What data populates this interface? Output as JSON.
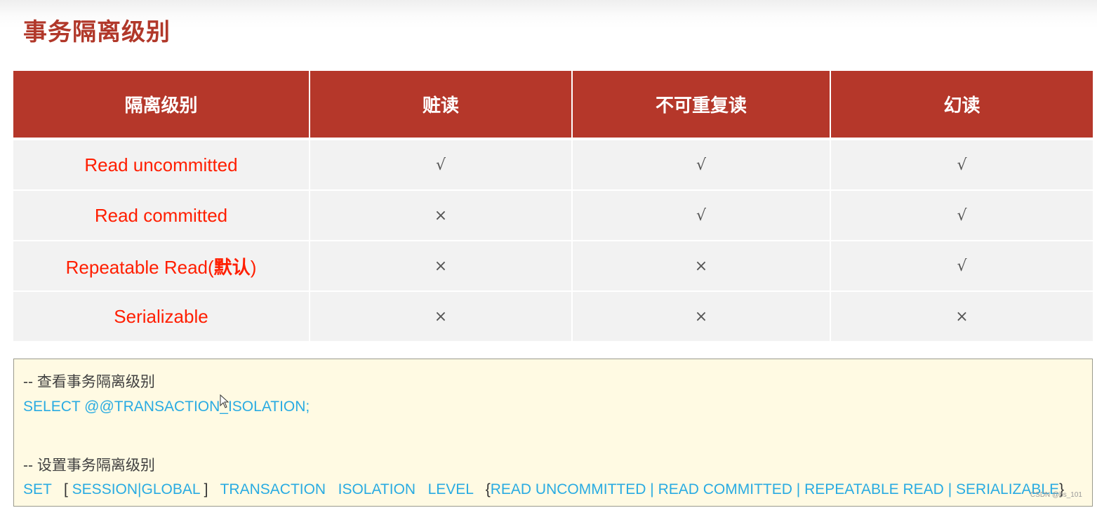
{
  "page": {
    "title": "事务隔离级别"
  },
  "table": {
    "headers": [
      "隔离级别",
      "赃读",
      "不可重复读",
      "幻读"
    ],
    "rows": [
      {
        "level": "Read uncommitted",
        "level_suffix": "",
        "dirty_read": "√",
        "non_repeatable_read": "√",
        "phantom_read": "√"
      },
      {
        "level": "Read committed",
        "level_suffix": "",
        "dirty_read": "×",
        "non_repeatable_read": "√",
        "phantom_read": "√"
      },
      {
        "level": "Repeatable Read(",
        "level_suffix": "默认",
        "level_close": ")",
        "dirty_read": "×",
        "non_repeatable_read": "×",
        "phantom_read": "√"
      },
      {
        "level": "Serializable",
        "level_suffix": "",
        "dirty_read": "×",
        "non_repeatable_read": "×",
        "phantom_read": "×"
      }
    ],
    "colors": {
      "header_bg": "#b5372a",
      "header_text": "#ffffff",
      "level_text": "#ff1e00",
      "cell_bg": "#f2f2f2"
    }
  },
  "code": {
    "comment_view": "-- 查看事务隔离级别",
    "select_stmt": "SELECT @@TRANSACTION_ISOLATION;",
    "comment_set": "-- 设置事务隔离级别",
    "set_parts": {
      "set": "SET",
      "open_bracket": "[",
      "session": "SESSION",
      "pipe1": "|",
      "global": "GLOBAL",
      "close_bracket": "]",
      "transaction": "TRANSACTION",
      "isolation": "ISOLATION",
      "level": "LEVEL",
      "open_brace": "{",
      "opt1": "READ UNCOMMITTED",
      "opt2": "READ COMMITTED",
      "opt3": "REPEATABLE READ",
      "opt4": "SERIALIZABLE",
      "sep": "|",
      "close_brace": "}"
    },
    "colors": {
      "keyword": "#29abe2",
      "comment": "#404040",
      "background": "#fffae3"
    }
  },
  "watermark": "CSDN @bs_101"
}
